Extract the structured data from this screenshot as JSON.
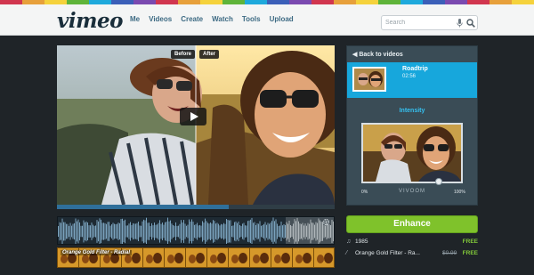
{
  "brand_stripe_colors": [
    "#d1364f",
    "#e7a03b",
    "#f5d23c",
    "#5fb43a",
    "#1ea9dc",
    "#3b5fb8",
    "#7a4ab0",
    "#d1364f",
    "#e7a03b",
    "#f5d23c",
    "#5fb43a",
    "#1ea9dc",
    "#3b5fb8",
    "#7a4ab0",
    "#d1364f",
    "#e7a03b",
    "#f5d23c",
    "#5fb43a",
    "#1ea9dc",
    "#3b5fb8",
    "#7a4ab0",
    "#d1364f",
    "#e7a03b",
    "#f5d23c"
  ],
  "header": {
    "logo": "vimeo",
    "nav": [
      "Me",
      "Videos",
      "Create",
      "Watch",
      "Tools",
      "Upload"
    ],
    "search_placeholder": "Search",
    "mic_icon": "microphone-icon",
    "search_icon": "magnifier-icon"
  },
  "player": {
    "before_label": "Before",
    "after_label": "After",
    "play_icon": "play-icon",
    "progress": 0.62
  },
  "audio_track": {
    "settings_icon": "settings-icon",
    "label": ""
  },
  "filter_track": {
    "label": "Orange Gold Filter - Radial"
  },
  "panel": {
    "back_label": "Back to videos",
    "back_icon": "arrow-left-icon",
    "clip_title": "Roadtrip",
    "clip_duration": "02:56",
    "intensity_label": "Intensity",
    "slider_min": "0%",
    "slider_max": "100%",
    "slider_brand": "VIVOOM",
    "intensity_value": 0.76
  },
  "enhance_label": "Enhance",
  "licenses": [
    {
      "icon": "music-note-icon",
      "glyph": "♫",
      "name": "1985",
      "old_price": "",
      "price": "FREE"
    },
    {
      "icon": "wand-icon",
      "glyph": "⁄",
      "name": "Orange Gold Filter - Ra...",
      "old_price": "$0.99",
      "price": "FREE"
    }
  ],
  "colors": {
    "accent_blue": "#17a7dc",
    "enhance_green": "#7fc22b",
    "free_green": "#82c83a",
    "background": "#1f2428"
  }
}
